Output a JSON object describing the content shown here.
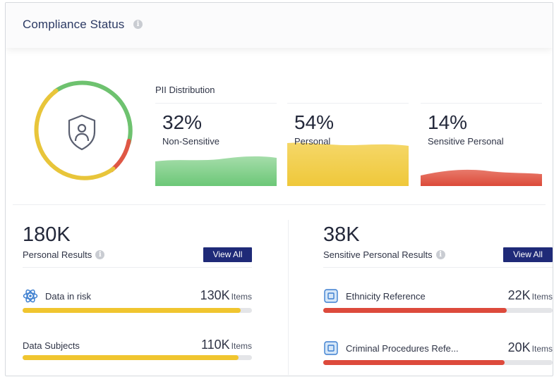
{
  "header": {
    "title": "Compliance Status",
    "info_icon": "info-icon"
  },
  "status_ring": {
    "center_icon": "shield-person-icon",
    "colors": {
      "green": "#6ec26f",
      "red": "#df5745",
      "yellow": "#e8c53a"
    }
  },
  "pii": {
    "title": "PII Distribution",
    "items": [
      {
        "percent": "32%",
        "label": "Non-Sensitive",
        "color": "#7fcf85"
      },
      {
        "percent": "54%",
        "label": "Personal",
        "color": "#f2cf4a"
      },
      {
        "percent": "14%",
        "label": "Sensitive Personal",
        "color": "#e0523f"
      }
    ]
  },
  "personal": {
    "count": "180K",
    "title": "Personal Results",
    "view_all": "View All",
    "rows": [
      {
        "label": "Data in risk",
        "value": "130K",
        "unit": "Items",
        "fill": 0.95,
        "color": "#f0c52f",
        "icon": "atom-icon"
      },
      {
        "label": "Data Subjects",
        "value": "110K",
        "unit": "Items",
        "fill": 0.94,
        "color": "#f0c52f"
      }
    ]
  },
  "sensitive": {
    "count": "38K",
    "title": "Sensitive Personal Results",
    "view_all": "View All",
    "rows": [
      {
        "label": "Ethnicity Reference",
        "value": "22K",
        "unit": "Items",
        "fill": 0.8,
        "color": "#dd4a3c",
        "icon": "id-chip-icon"
      },
      {
        "label": "Criminal Procedures Refe...",
        "value": "20K",
        "unit": "Items",
        "fill": 0.79,
        "color": "#dd4a3c",
        "icon": "id-chip-icon"
      }
    ]
  }
}
